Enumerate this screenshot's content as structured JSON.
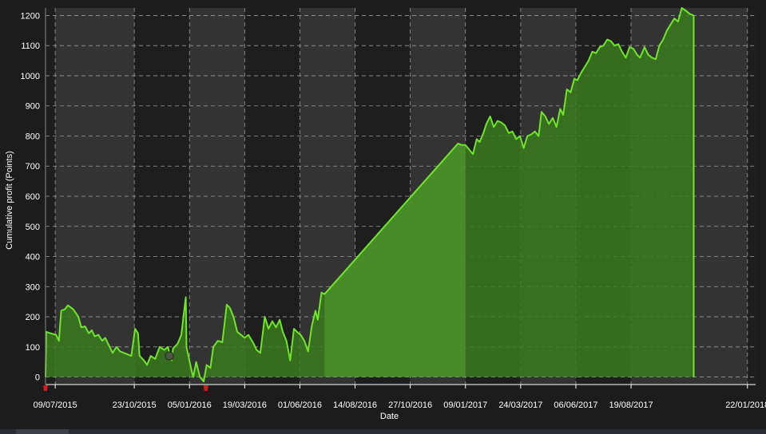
{
  "colors": {
    "background": "#1c1c1c",
    "band_light": "#333333",
    "band_dark": "#1e1e1e",
    "grid": "#9a9a9a",
    "area_fill": "#3a7a1e",
    "area_fill_alt": "#4a8f2a",
    "line": "#6fe62a",
    "axis_text": "#ffffff",
    "drawdown_marker": "#d11a1a",
    "circle_marker": "#4a5a42"
  },
  "chart_data": {
    "type": "area",
    "title": "",
    "xlabel": "Date",
    "ylabel": "Cumulative profit (Points)",
    "xlim": [
      "2015-06-26",
      "2018-02-02"
    ],
    "ylim": [
      -25,
      1225
    ],
    "x_ticks": [
      "09/07/2015",
      "23/10/2015",
      "05/01/2016",
      "19/03/2016",
      "01/06/2016",
      "14/08/2016",
      "27/10/2016",
      "09/01/2017",
      "24/03/2017",
      "06/06/2017",
      "19/08/2017",
      "22/01/2018"
    ],
    "y_ticks": [
      0,
      100,
      200,
      300,
      400,
      500,
      600,
      700,
      800,
      900,
      1000,
      1100,
      1200
    ],
    "grid": true,
    "legend": "none",
    "series": [
      {
        "points": [
          [
            "2015-06-26",
            0
          ],
          [
            "2015-06-27",
            150
          ],
          [
            "2015-07-03",
            145
          ],
          [
            "2015-07-10",
            140
          ],
          [
            "2015-07-14",
            120
          ],
          [
            "2015-07-17",
            220
          ],
          [
            "2015-07-22",
            225
          ],
          [
            "2015-07-26",
            238
          ],
          [
            "2015-08-02",
            225
          ],
          [
            "2015-08-09",
            200
          ],
          [
            "2015-08-13",
            165
          ],
          [
            "2015-08-18",
            168
          ],
          [
            "2015-08-23",
            145
          ],
          [
            "2015-08-27",
            155
          ],
          [
            "2015-08-31",
            135
          ],
          [
            "2015-09-05",
            140
          ],
          [
            "2015-09-10",
            120
          ],
          [
            "2015-09-14",
            130
          ],
          [
            "2015-09-19",
            105
          ],
          [
            "2015-09-24",
            80
          ],
          [
            "2015-09-29",
            100
          ],
          [
            "2015-10-04",
            85
          ],
          [
            "2015-10-14",
            75
          ],
          [
            "2015-10-19",
            70
          ],
          [
            "2015-10-24",
            160
          ],
          [
            "2015-10-28",
            145
          ],
          [
            "2015-10-30",
            70
          ],
          [
            "2015-11-05",
            55
          ],
          [
            "2015-11-09",
            40
          ],
          [
            "2015-11-14",
            70
          ],
          [
            "2015-11-20",
            60
          ],
          [
            "2015-11-26",
            100
          ],
          [
            "2015-12-02",
            90
          ],
          [
            "2015-12-07",
            100
          ],
          [
            "2015-12-12",
            55
          ],
          [
            "2015-12-14",
            95
          ],
          [
            "2015-12-20",
            110
          ],
          [
            "2015-12-25",
            140
          ],
          [
            "2015-12-31",
            265
          ],
          [
            "2016-01-01",
            100
          ],
          [
            "2016-01-07",
            30
          ],
          [
            "2016-01-10",
            0
          ],
          [
            "2016-01-14",
            50
          ],
          [
            "2016-01-19",
            0
          ],
          [
            "2016-01-24",
            -15
          ],
          [
            "2016-01-28",
            40
          ],
          [
            "2016-02-02",
            30
          ],
          [
            "2016-02-06",
            100
          ],
          [
            "2016-02-12",
            120
          ],
          [
            "2016-02-18",
            115
          ],
          [
            "2016-02-24",
            240
          ],
          [
            "2016-02-28",
            230
          ],
          [
            "2016-03-04",
            200
          ],
          [
            "2016-03-09",
            150
          ],
          [
            "2016-03-14",
            140
          ],
          [
            "2016-03-19",
            130
          ],
          [
            "2016-03-24",
            140
          ],
          [
            "2016-03-30",
            115
          ],
          [
            "2016-04-04",
            90
          ],
          [
            "2016-04-09",
            80
          ],
          [
            "2016-04-15",
            200
          ],
          [
            "2016-04-20",
            160
          ],
          [
            "2016-04-25",
            185
          ],
          [
            "2016-04-30",
            165
          ],
          [
            "2016-05-05",
            190
          ],
          [
            "2016-05-09",
            150
          ],
          [
            "2016-05-14",
            120
          ],
          [
            "2016-05-19",
            55
          ],
          [
            "2016-05-24",
            160
          ],
          [
            "2016-05-28",
            150
          ],
          [
            "2016-06-02",
            140
          ],
          [
            "2016-06-07",
            120
          ],
          [
            "2016-06-12",
            85
          ],
          [
            "2016-06-17",
            170
          ],
          [
            "2016-06-22",
            220
          ],
          [
            "2016-06-25",
            190
          ],
          [
            "2016-06-30",
            280
          ],
          [
            "2016-07-04",
            275
          ],
          [
            "2016-12-30",
            775
          ],
          [
            "2017-01-04",
            770
          ],
          [
            "2017-01-09",
            770
          ],
          [
            "2017-01-14",
            755
          ],
          [
            "2017-01-19",
            740
          ],
          [
            "2017-01-24",
            790
          ],
          [
            "2017-01-28",
            780
          ],
          [
            "2017-02-02",
            810
          ],
          [
            "2017-02-06",
            840
          ],
          [
            "2017-02-11",
            865
          ],
          [
            "2017-02-16",
            830
          ],
          [
            "2017-02-21",
            850
          ],
          [
            "2017-02-26",
            845
          ],
          [
            "2017-03-03",
            835
          ],
          [
            "2017-03-08",
            810
          ],
          [
            "2017-03-13",
            815
          ],
          [
            "2017-03-18",
            790
          ],
          [
            "2017-03-23",
            800
          ],
          [
            "2017-03-28",
            760
          ],
          [
            "2017-04-02",
            800
          ],
          [
            "2017-04-07",
            805
          ],
          [
            "2017-04-12",
            815
          ],
          [
            "2017-04-17",
            800
          ],
          [
            "2017-04-21",
            880
          ],
          [
            "2017-04-26",
            865
          ],
          [
            "2017-05-01",
            840
          ],
          [
            "2017-05-06",
            860
          ],
          [
            "2017-05-11",
            830
          ],
          [
            "2017-05-16",
            890
          ],
          [
            "2017-05-20",
            870
          ],
          [
            "2017-05-25",
            955
          ],
          [
            "2017-05-30",
            945
          ],
          [
            "2017-06-04",
            990
          ],
          [
            "2017-06-08",
            985
          ],
          [
            "2017-06-13",
            1010
          ],
          [
            "2017-06-18",
            1030
          ],
          [
            "2017-06-23",
            1050
          ],
          [
            "2017-06-28",
            1080
          ],
          [
            "2017-07-03",
            1075
          ],
          [
            "2017-07-08",
            1095
          ],
          [
            "2017-07-13",
            1100
          ],
          [
            "2017-07-18",
            1120
          ],
          [
            "2017-07-23",
            1115
          ],
          [
            "2017-07-28",
            1100
          ],
          [
            "2017-08-02",
            1105
          ],
          [
            "2017-08-07",
            1080
          ],
          [
            "2017-08-12",
            1060
          ],
          [
            "2017-08-17",
            1095
          ],
          [
            "2017-08-22",
            1090
          ],
          [
            "2017-08-27",
            1070
          ],
          [
            "2017-08-31",
            1060
          ],
          [
            "2017-09-06",
            1095
          ],
          [
            "2017-09-11",
            1070
          ],
          [
            "2017-09-16",
            1060
          ],
          [
            "2017-09-21",
            1055
          ],
          [
            "2017-09-26",
            1100
          ],
          [
            "2017-10-01",
            1120
          ],
          [
            "2017-10-06",
            1150
          ],
          [
            "2017-10-11",
            1170
          ],
          [
            "2017-10-16",
            1190
          ],
          [
            "2017-10-21",
            1180
          ],
          [
            "2017-10-26",
            1225
          ],
          [
            "2017-11-01",
            1215
          ],
          [
            "2017-11-06",
            1205
          ],
          [
            "2017-11-11",
            1200
          ]
        ]
      }
    ],
    "markers": [
      {
        "date": "2015-12-09",
        "value": 70,
        "shape": "circle"
      },
      {
        "date": "2016-01-27",
        "value": -10,
        "shape": "drawdown"
      },
      {
        "date": "2015-06-26",
        "value": 0,
        "shape": "drawdown"
      }
    ]
  }
}
